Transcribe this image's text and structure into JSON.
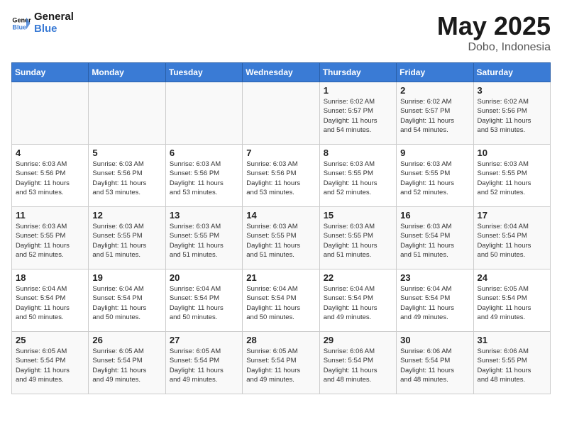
{
  "logo": {
    "line1": "General",
    "line2": "Blue"
  },
  "title": "May 2025",
  "subtitle": "Dobo, Indonesia",
  "days_header": [
    "Sunday",
    "Monday",
    "Tuesday",
    "Wednesday",
    "Thursday",
    "Friday",
    "Saturday"
  ],
  "weeks": [
    [
      {
        "num": "",
        "info": ""
      },
      {
        "num": "",
        "info": ""
      },
      {
        "num": "",
        "info": ""
      },
      {
        "num": "",
        "info": ""
      },
      {
        "num": "1",
        "info": "Sunrise: 6:02 AM\nSunset: 5:57 PM\nDaylight: 11 hours\nand 54 minutes."
      },
      {
        "num": "2",
        "info": "Sunrise: 6:02 AM\nSunset: 5:57 PM\nDaylight: 11 hours\nand 54 minutes."
      },
      {
        "num": "3",
        "info": "Sunrise: 6:02 AM\nSunset: 5:56 PM\nDaylight: 11 hours\nand 53 minutes."
      }
    ],
    [
      {
        "num": "4",
        "info": "Sunrise: 6:03 AM\nSunset: 5:56 PM\nDaylight: 11 hours\nand 53 minutes."
      },
      {
        "num": "5",
        "info": "Sunrise: 6:03 AM\nSunset: 5:56 PM\nDaylight: 11 hours\nand 53 minutes."
      },
      {
        "num": "6",
        "info": "Sunrise: 6:03 AM\nSunset: 5:56 PM\nDaylight: 11 hours\nand 53 minutes."
      },
      {
        "num": "7",
        "info": "Sunrise: 6:03 AM\nSunset: 5:56 PM\nDaylight: 11 hours\nand 53 minutes."
      },
      {
        "num": "8",
        "info": "Sunrise: 6:03 AM\nSunset: 5:55 PM\nDaylight: 11 hours\nand 52 minutes."
      },
      {
        "num": "9",
        "info": "Sunrise: 6:03 AM\nSunset: 5:55 PM\nDaylight: 11 hours\nand 52 minutes."
      },
      {
        "num": "10",
        "info": "Sunrise: 6:03 AM\nSunset: 5:55 PM\nDaylight: 11 hours\nand 52 minutes."
      }
    ],
    [
      {
        "num": "11",
        "info": "Sunrise: 6:03 AM\nSunset: 5:55 PM\nDaylight: 11 hours\nand 52 minutes."
      },
      {
        "num": "12",
        "info": "Sunrise: 6:03 AM\nSunset: 5:55 PM\nDaylight: 11 hours\nand 51 minutes."
      },
      {
        "num": "13",
        "info": "Sunrise: 6:03 AM\nSunset: 5:55 PM\nDaylight: 11 hours\nand 51 minutes."
      },
      {
        "num": "14",
        "info": "Sunrise: 6:03 AM\nSunset: 5:55 PM\nDaylight: 11 hours\nand 51 minutes."
      },
      {
        "num": "15",
        "info": "Sunrise: 6:03 AM\nSunset: 5:55 PM\nDaylight: 11 hours\nand 51 minutes."
      },
      {
        "num": "16",
        "info": "Sunrise: 6:03 AM\nSunset: 5:54 PM\nDaylight: 11 hours\nand 51 minutes."
      },
      {
        "num": "17",
        "info": "Sunrise: 6:04 AM\nSunset: 5:54 PM\nDaylight: 11 hours\nand 50 minutes."
      }
    ],
    [
      {
        "num": "18",
        "info": "Sunrise: 6:04 AM\nSunset: 5:54 PM\nDaylight: 11 hours\nand 50 minutes."
      },
      {
        "num": "19",
        "info": "Sunrise: 6:04 AM\nSunset: 5:54 PM\nDaylight: 11 hours\nand 50 minutes."
      },
      {
        "num": "20",
        "info": "Sunrise: 6:04 AM\nSunset: 5:54 PM\nDaylight: 11 hours\nand 50 minutes."
      },
      {
        "num": "21",
        "info": "Sunrise: 6:04 AM\nSunset: 5:54 PM\nDaylight: 11 hours\nand 50 minutes."
      },
      {
        "num": "22",
        "info": "Sunrise: 6:04 AM\nSunset: 5:54 PM\nDaylight: 11 hours\nand 49 minutes."
      },
      {
        "num": "23",
        "info": "Sunrise: 6:04 AM\nSunset: 5:54 PM\nDaylight: 11 hours\nand 49 minutes."
      },
      {
        "num": "24",
        "info": "Sunrise: 6:05 AM\nSunset: 5:54 PM\nDaylight: 11 hours\nand 49 minutes."
      }
    ],
    [
      {
        "num": "25",
        "info": "Sunrise: 6:05 AM\nSunset: 5:54 PM\nDaylight: 11 hours\nand 49 minutes."
      },
      {
        "num": "26",
        "info": "Sunrise: 6:05 AM\nSunset: 5:54 PM\nDaylight: 11 hours\nand 49 minutes."
      },
      {
        "num": "27",
        "info": "Sunrise: 6:05 AM\nSunset: 5:54 PM\nDaylight: 11 hours\nand 49 minutes."
      },
      {
        "num": "28",
        "info": "Sunrise: 6:05 AM\nSunset: 5:54 PM\nDaylight: 11 hours\nand 49 minutes."
      },
      {
        "num": "29",
        "info": "Sunrise: 6:06 AM\nSunset: 5:54 PM\nDaylight: 11 hours\nand 48 minutes."
      },
      {
        "num": "30",
        "info": "Sunrise: 6:06 AM\nSunset: 5:54 PM\nDaylight: 11 hours\nand 48 minutes."
      },
      {
        "num": "31",
        "info": "Sunrise: 6:06 AM\nSunset: 5:55 PM\nDaylight: 11 hours\nand 48 minutes."
      }
    ]
  ]
}
